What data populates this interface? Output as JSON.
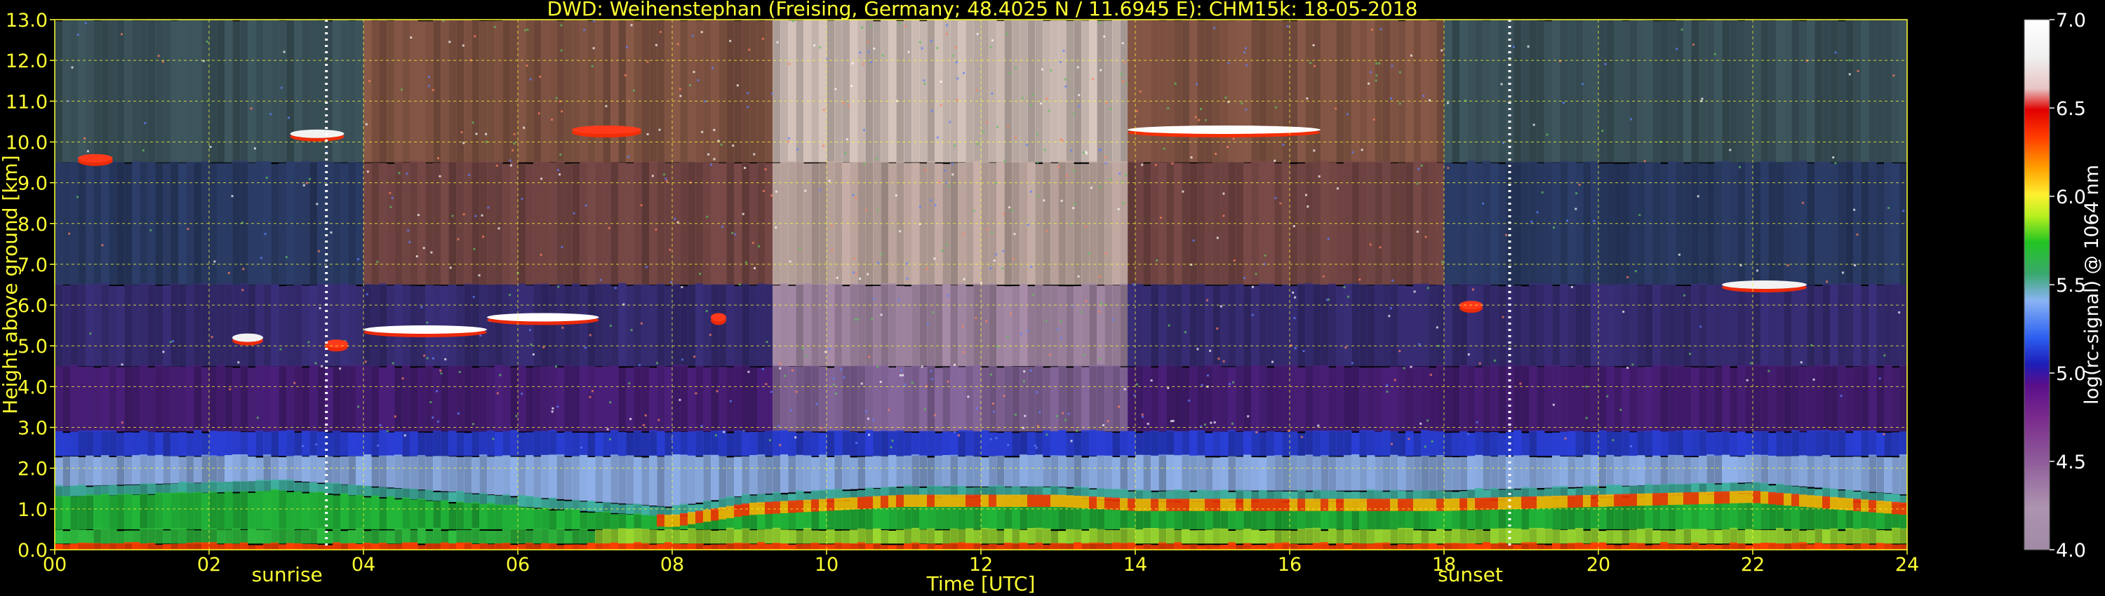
{
  "chart_data": {
    "type": "heatmap",
    "title": "DWD: Weihenstephan (Freising, Germany; 48.4025 N / 11.6945 E):    CHM15k: 18-05-2018",
    "xlabel": "Time [UTC]",
    "ylabel": "Height above ground [km]",
    "xlim": [
      0,
      24
    ],
    "ylim": [
      0,
      13
    ],
    "x_ticks": [
      "00",
      "02",
      "04",
      "06",
      "08",
      "10",
      "12",
      "14",
      "16",
      "18",
      "20",
      "22",
      "24"
    ],
    "x_tick_values": [
      0,
      2,
      4,
      6,
      8,
      10,
      12,
      14,
      16,
      18,
      20,
      22,
      24
    ],
    "y_ticks": [
      "0.0",
      "1.0",
      "2.0",
      "3.0",
      "4.0",
      "5.0",
      "6.0",
      "7.0",
      "8.0",
      "9.0",
      "10.0",
      "11.0",
      "12.0",
      "13.0"
    ],
    "y_tick_values": [
      0,
      1,
      2,
      3,
      4,
      5,
      6,
      7,
      8,
      9,
      10,
      11,
      12,
      13
    ],
    "grid": true,
    "colorbar": {
      "label": "log(rc-signal) @ 1064 nm",
      "range": [
        4.0,
        7.0
      ],
      "ticks": [
        "4.0",
        "4.5",
        "5.0",
        "5.5",
        "6.0",
        "6.5",
        "7.0"
      ],
      "tick_values": [
        4.0,
        4.5,
        5.0,
        5.5,
        6.0,
        6.5,
        7.0
      ]
    },
    "events": [
      {
        "label": "sunrise",
        "time": 3.52
      },
      {
        "label": "sunset",
        "time": 18.85
      }
    ],
    "cloud_layers": [
      {
        "t_start": 0.3,
        "t_end": 0.75,
        "height_km": 9.6,
        "intensity": 6.3
      },
      {
        "t_start": 3.05,
        "t_end": 3.75,
        "height_km": 10.2,
        "intensity": 6.6
      },
      {
        "t_start": 2.3,
        "t_end": 2.7,
        "height_km": 5.2,
        "intensity": 6.5
      },
      {
        "t_start": 3.5,
        "t_end": 3.8,
        "height_km": 5.05,
        "intensity": 6.3
      },
      {
        "t_start": 4.0,
        "t_end": 5.6,
        "height_km": 5.4,
        "intensity": 6.9
      },
      {
        "t_start": 5.6,
        "t_end": 7.05,
        "height_km": 5.7,
        "intensity": 6.8
      },
      {
        "t_start": 6.7,
        "t_end": 7.6,
        "height_km": 10.3,
        "intensity": 6.4
      },
      {
        "t_start": 8.5,
        "t_end": 8.7,
        "height_km": 5.7,
        "intensity": 6.3
      },
      {
        "t_start": 13.9,
        "t_end": 16.4,
        "height_km": 10.3,
        "intensity": 6.9
      },
      {
        "t_start": 18.2,
        "t_end": 18.5,
        "height_km": 6.0,
        "intensity": 6.4
      },
      {
        "t_start": 21.6,
        "t_end": 22.7,
        "height_km": 6.5,
        "intensity": 6.5
      }
    ],
    "boundary_layer_top": [
      {
        "time": 0,
        "height_km": 1.3
      },
      {
        "time": 3,
        "height_km": 1.45
      },
      {
        "time": 8,
        "height_km": 0.8
      },
      {
        "time": 9,
        "height_km": 1.1
      },
      {
        "time": 11,
        "height_km": 1.3
      },
      {
        "time": 13,
        "height_km": 1.3
      },
      {
        "time": 14,
        "height_km": 1.2
      },
      {
        "time": 18,
        "height_km": 1.2
      },
      {
        "time": 22,
        "height_km": 1.4
      },
      {
        "time": 24,
        "height_km": 1.1
      }
    ]
  }
}
